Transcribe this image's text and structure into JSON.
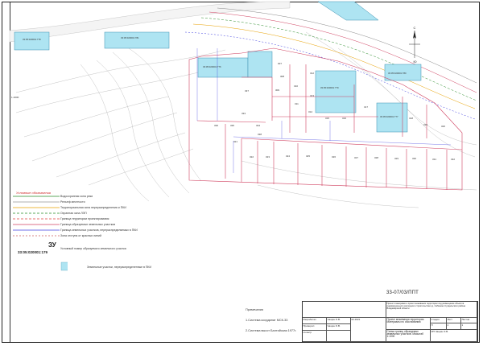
{
  "map": {
    "left_edge_label": "1·2000",
    "parcel_numbers": [
      "307",
      "308",
      "309",
      "310",
      "311",
      "312",
      "313",
      "314",
      "315",
      "316",
      "317",
      "318",
      "319",
      "320",
      "321",
      "322",
      "323",
      "324",
      "325",
      "326",
      "327",
      "328",
      "329",
      "330",
      "331",
      "332",
      "333",
      "334",
      "335",
      "336",
      "337",
      "338"
    ],
    "zone_labels": [
      "33:05:020001:778",
      "33:05:020001:781",
      "33:05:020001:776",
      "33:05:020001:779",
      "33:05:020001:777",
      "33:05:020001:780"
    ]
  },
  "compass": {
    "north": "С",
    "south": "Ю"
  },
  "legend": {
    "title": "Условные обозначения",
    "items": [
      {
        "label": "Водоохранная зона реки",
        "color": "#2a8c2a",
        "style": "solid"
      },
      {
        "label": "Рельеф местности",
        "color": "#999999",
        "style": "solid"
      },
      {
        "label": "Территориальная зона перераспределения и ПКИ",
        "color": "#e8a000",
        "style": "solid"
      },
      {
        "label": "Охранная зона ЛЭП",
        "color": "#2a8c2a",
        "style": "dash"
      },
      {
        "label": "Граница территории проектирования",
        "color": "#e04040",
        "style": "dash"
      },
      {
        "label": "Граница образуемых земельных участков",
        "color": "#d04060",
        "style": "solid"
      },
      {
        "label": "Граница земельных участков, перераспределяемых в ПКИ",
        "color": "#4040e0",
        "style": "solid"
      },
      {
        "label": "Зона отступа от красных линий",
        "color": "#cc6060",
        "style": "dash"
      }
    ],
    "cadastral_number": "33:05:020001:179",
    "cadastral_label": "Условный номер образуемого земельного участка",
    "zu_label": "ЗУ",
    "parcel_label": "Земельные участки, перераспределенные в ПКИ",
    "swatch_color": "#aee4f2"
  },
  "notes": {
    "title": "Примечания",
    "line1": "1.Система координат МСК-33",
    "line2": "2.Система высот Балтийская 1977г."
  },
  "stamp": {
    "code": "33-07/03/ППТ",
    "project_desc": "Проект планировки и проект межевания территории под размещение объектов индивидуального жилищного строительства в д. Сабинино Суздальского района Владимирской области",
    "drawing_title": "Проект межевания территории. Материалы по обоснованию",
    "sheet_title": "Схема границ образуемых земельных участков. Масштаб 1:1000",
    "stage": "Стадия",
    "sheet": "Лист",
    "sheets": "Листов",
    "stage_val": "П",
    "sheet_val": "1",
    "sheets_val": "1",
    "org": "ИП Чащин О.В.",
    "roles": [
      "Разработал",
      "Проверил",
      "Н.контр"
    ],
    "names": [
      "Чащин О.В.",
      "Чащин О.В.",
      ""
    ],
    "date": "02.2021"
  }
}
